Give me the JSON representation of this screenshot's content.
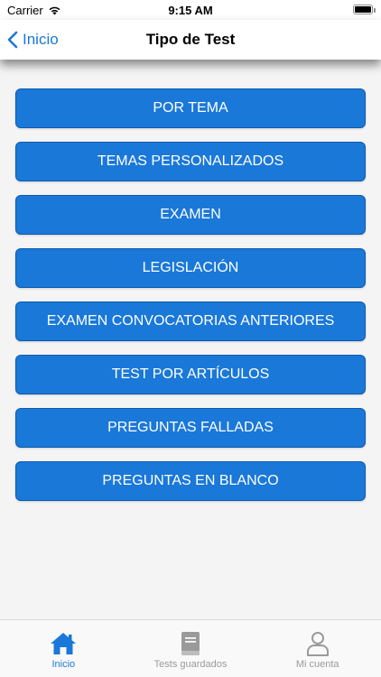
{
  "status_bar": {
    "carrier": "Carrier",
    "time": "9:15 AM"
  },
  "nav": {
    "back_label": "Inicio",
    "title": "Tipo de Test"
  },
  "options": [
    {
      "label": "POR TEMA"
    },
    {
      "label": "TEMAS PERSONALIZADOS"
    },
    {
      "label": "EXAMEN"
    },
    {
      "label": "LEGISLACIÓN"
    },
    {
      "label": "EXAMEN CONVOCATORIAS ANTERIORES"
    },
    {
      "label": "TEST POR ARTÍCULOS"
    },
    {
      "label": "PREGUNTAS FALLADAS"
    },
    {
      "label": "PREGUNTAS EN BLANCO"
    }
  ],
  "tab_bar": {
    "tabs": [
      {
        "label": "Inicio",
        "icon": "home-icon",
        "active": true
      },
      {
        "label": "Tests guardados",
        "icon": "book-icon",
        "active": false
      },
      {
        "label": "Mi cuenta",
        "icon": "person-icon",
        "active": false
      }
    ]
  },
  "colors": {
    "accent": "#1a78d9",
    "button_border": "#0d5bad",
    "background": "#f4f4f4",
    "inactive": "#9a9a9a"
  }
}
